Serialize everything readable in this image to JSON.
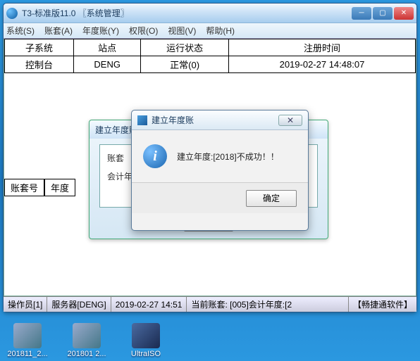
{
  "main_window": {
    "title": "T3-标准版11.0 〖系统管理〗",
    "menu": [
      "系统(S)",
      "账套(A)",
      "年度账(Y)",
      "权限(O)",
      "视图(V)",
      "帮助(H)"
    ]
  },
  "grid": {
    "headers": [
      "子系统",
      "站点",
      "运行状态",
      "注册时间"
    ],
    "row": [
      "控制台",
      "DENG",
      "正常(0)",
      "2019-02-27 14:48:07"
    ]
  },
  "subheader": [
    "账套号",
    "年度"
  ],
  "dialog1": {
    "title": "建立年度账",
    "label_account": "账套",
    "label_year": "会计年度"
  },
  "alert": {
    "title": "建立年度账",
    "message": "建立年度:[2018]不成功！！",
    "ok": "确定"
  },
  "status": {
    "operator": "操作员[1]",
    "server": "服务器[DENG]",
    "time": "2019-02-27 14:51",
    "current": "当前账套: [005]会计年度:[2",
    "brand": "【畅捷通软件】"
  },
  "desktop": {
    "i1": "201811_2...",
    "i2": "201801 2...",
    "i3": "UltraISO"
  }
}
